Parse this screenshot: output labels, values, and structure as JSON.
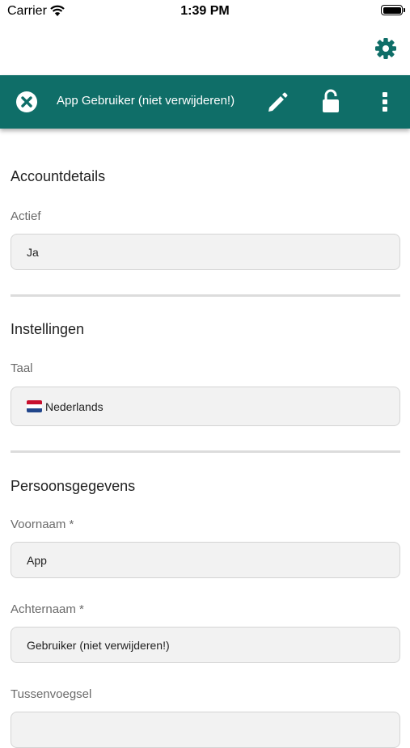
{
  "status_bar": {
    "carrier": "Carrier",
    "time": "1:39 PM"
  },
  "top": {
    "settings_icon": "gear-icon"
  },
  "header": {
    "title": "App Gebruiker (niet verwijderen!)",
    "background_color": "#0f6e68",
    "close_icon": "close-circle-icon",
    "edit_icon": "pencil-icon",
    "lock_icon": "unlocked-icon",
    "more_icon": "more-vertical-icon"
  },
  "sections": {
    "account": {
      "title": "Accountdetails",
      "active_label": "Actief",
      "active_value": "Ja"
    },
    "settings": {
      "title": "Instellingen",
      "language_label": "Taal",
      "language_value": "Nederlands",
      "language_flag_icon": "netherlands-flag-icon"
    },
    "personal": {
      "title": "Persoonsgegevens",
      "first_name_label": "Voornaam *",
      "first_name_value": "App",
      "last_name_label": "Achternaam *",
      "last_name_value": "Gebruiker (niet verwijderen!)",
      "infix_label": "Tussenvoegsel",
      "infix_value": ""
    }
  }
}
